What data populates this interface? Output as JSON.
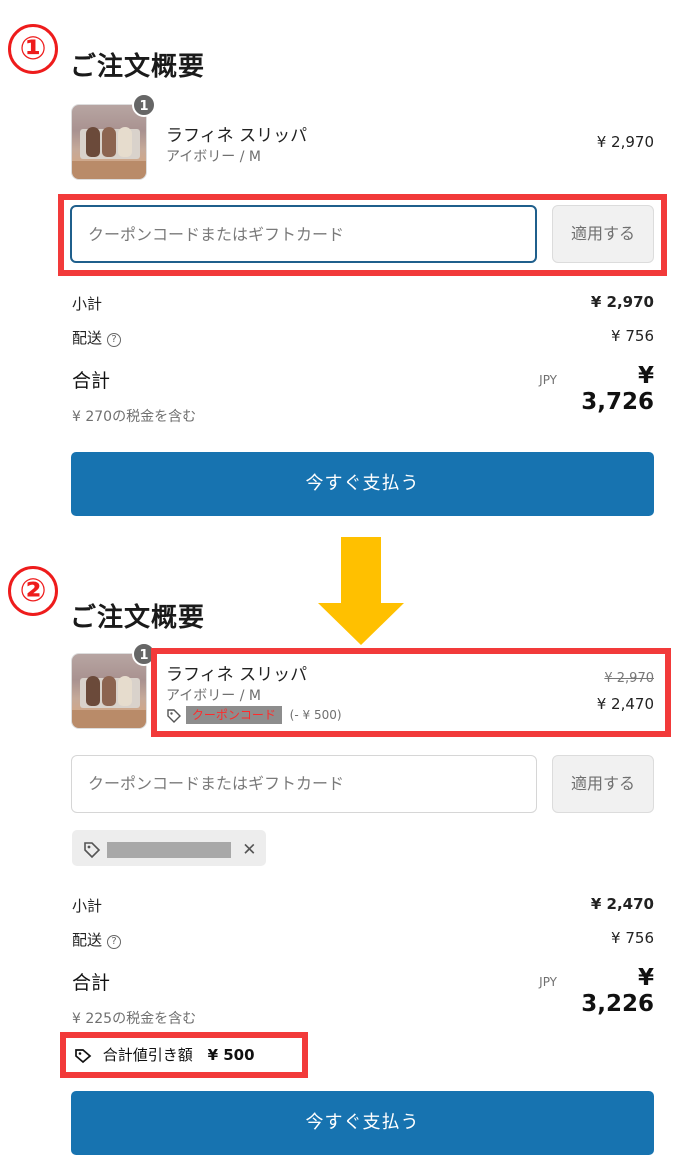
{
  "step1": {
    "number": "①",
    "heading": "ご注文概要",
    "product": {
      "qty": "1",
      "name": "ラフィネ スリッパ",
      "variant": "アイボリー / M",
      "price": "¥ 2,970"
    },
    "coupon_placeholder": "クーポンコードまたはギフトカード",
    "apply_label": "適用する",
    "subtotal_label": "小計",
    "subtotal_value": "¥ 2,970",
    "shipping_label": "配送",
    "shipping_value": "¥ 756",
    "total_label": "合計",
    "currency": "JPY",
    "total_value": "¥ 3,726",
    "tax_note": "¥ 270の税金を含む",
    "pay_label": "今すぐ支払う"
  },
  "step2": {
    "number": "②",
    "heading": "ご注文概要",
    "product": {
      "qty": "1",
      "name": "ラフィネ スリッパ",
      "variant": "アイボリー / M",
      "coupon_tag": "クーポンコード",
      "coupon_discount": "(- ¥ 500)",
      "original_price": "¥ 2,970",
      "price": "¥ 2,470"
    },
    "coupon_placeholder": "クーポンコードまたはギフトカード",
    "apply_label": "適用する",
    "chip_remove": "✕",
    "subtotal_label": "小計",
    "subtotal_value": "¥ 2,470",
    "shipping_label": "配送",
    "shipping_value": "¥ 756",
    "total_label": "合計",
    "currency": "JPY",
    "total_value": "¥ 3,226",
    "tax_note": "¥ 225の税金を含む",
    "discount_label": "合計値引き額",
    "discount_value": "¥ 500",
    "pay_label": "今すぐ支払う"
  },
  "icons": {
    "tag": "tag-icon",
    "help": "help-circle-icon",
    "arrow": "down-arrow-icon",
    "close": "close-icon"
  },
  "colors": {
    "pay_button": "#1773b0",
    "highlight_box": "#f23a3a",
    "arrow": "#ffc000",
    "step_number": "#ee1c1c"
  }
}
